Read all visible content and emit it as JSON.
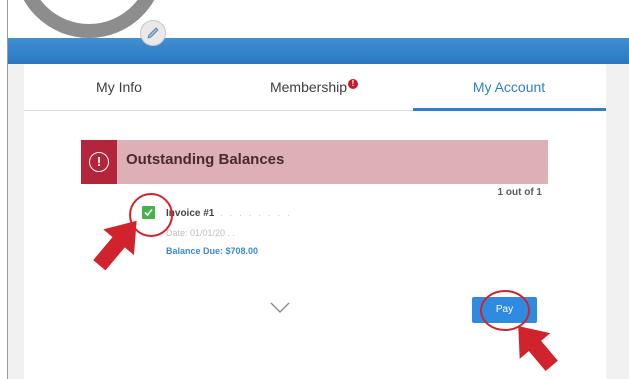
{
  "tabs": {
    "my_info": "My Info",
    "membership": "Membership",
    "membership_badge": "!",
    "my_account": "My Account"
  },
  "balances": {
    "title": "Outstanding Balances",
    "alert_symbol": "!",
    "count": "1 out of 1"
  },
  "invoice": {
    "label": "Invoice #1",
    "obscured_id": ". . . . . . . .",
    "date": "Date: 01/01/20 . .",
    "balance_due": "Balance Due: $708.00",
    "selected": true
  },
  "actions": {
    "pay_label": "Pay"
  },
  "icons": {
    "edit": "pencil-icon",
    "alert": "alert-circle-icon",
    "check": "check-icon",
    "chevron": "chevron-down-icon",
    "pointer": "arrow-pointer-icon"
  },
  "colors": {
    "accent_blue": "#2f7fc8",
    "header_band": "#2a78c4",
    "alert_red": "#b4243a",
    "balances_bg": "#dcb0b4",
    "checkbox_green": "#49b14b",
    "pay_button": "#2f8be0",
    "annotation_red": "#d1232c"
  }
}
